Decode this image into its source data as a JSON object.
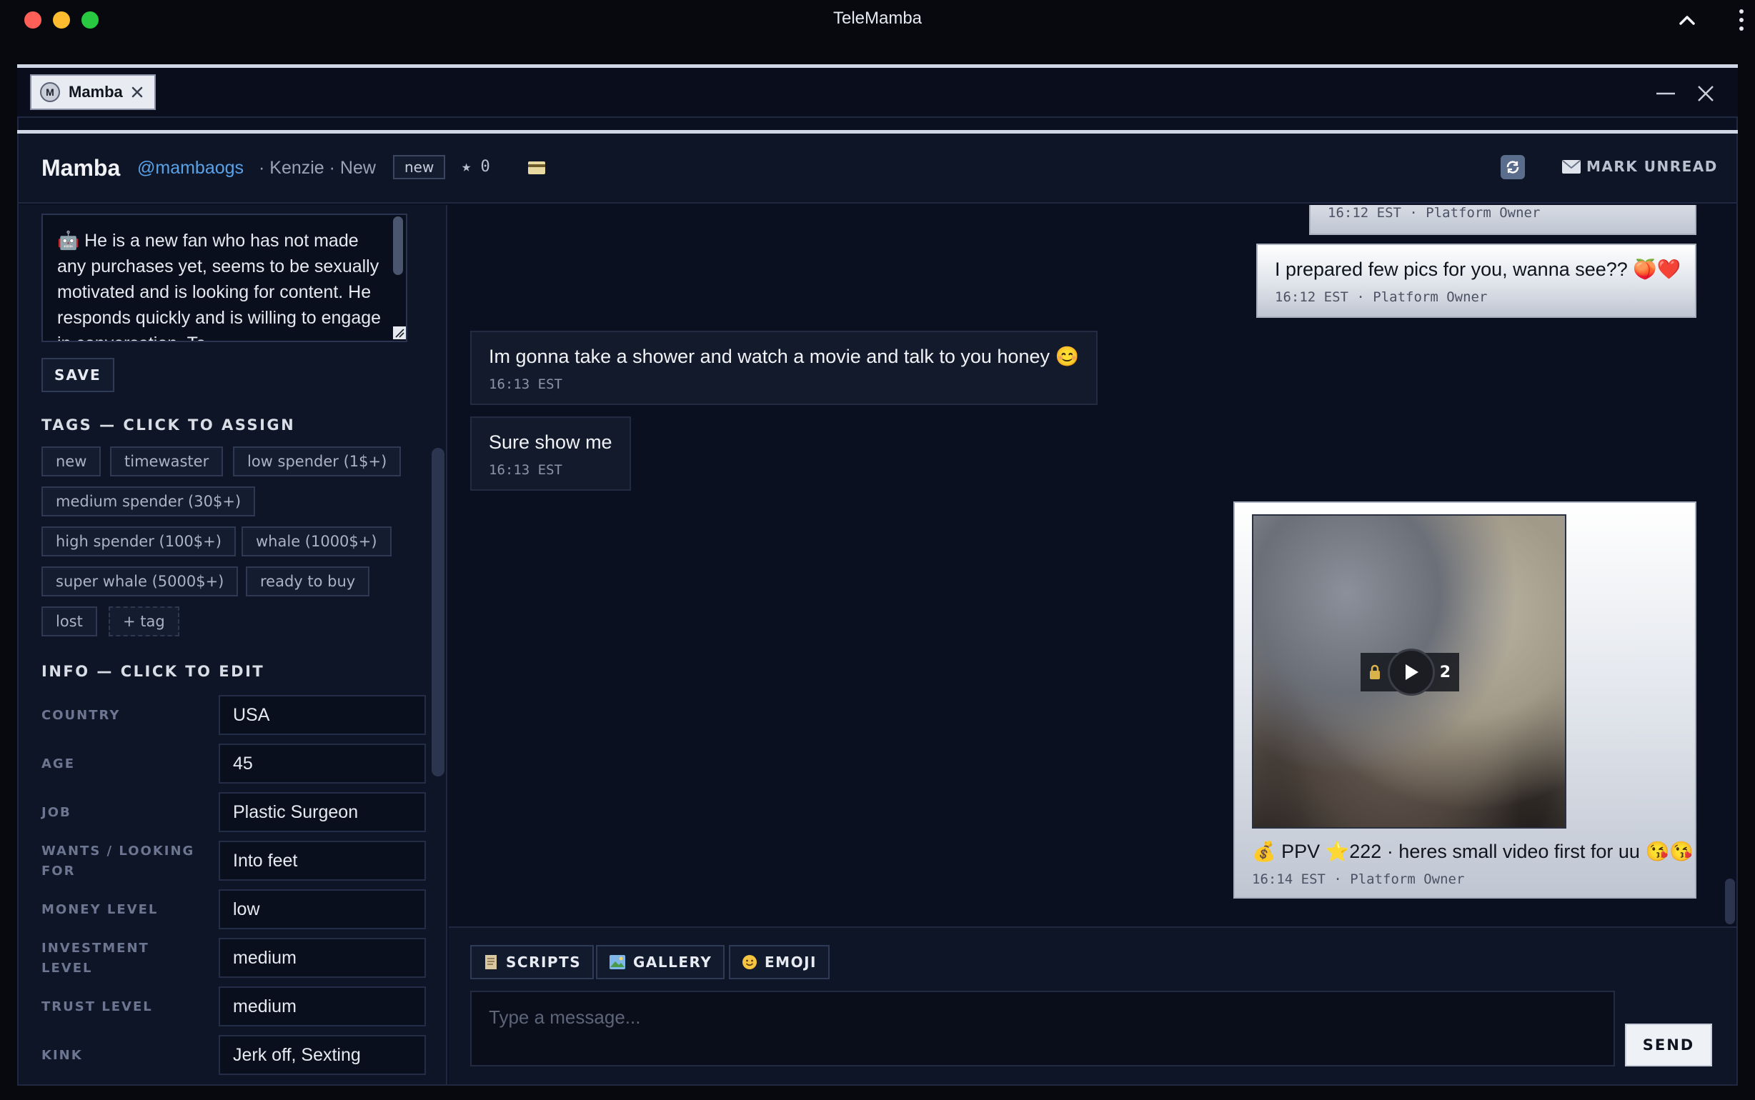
{
  "app": {
    "title": "TeleMamba"
  },
  "tab": {
    "avatar_letter": "M",
    "label": "Mamba"
  },
  "header": {
    "name": "Mamba",
    "handle": "@mambaogs",
    "meta": "· Kenzie · New",
    "badge": "new",
    "stars": "★ 0",
    "mark_unread": "MARK UNREAD"
  },
  "notes": {
    "text": "🤖 He is a new fan who has not made any purchases yet, seems to be sexually motivated and is looking for content. He responds quickly and is willing to engage in conversation. To"
  },
  "save_label": "SAVE",
  "tags": {
    "title": "TAGS — CLICK TO ASSIGN",
    "items": [
      "new",
      "timewaster",
      "low spender (1$+)",
      "medium spender (30$+)",
      "high spender (100$+)",
      "whale (1000$+)",
      "super whale (5000$+)",
      "ready to buy",
      "lost",
      "+ tag"
    ]
  },
  "info": {
    "title": "INFO — CLICK TO EDIT",
    "rows": [
      {
        "label": "COUNTRY",
        "value": "USA"
      },
      {
        "label": "AGE",
        "value": "45"
      },
      {
        "label": "JOB",
        "value": "Plastic Surgeon"
      },
      {
        "label": "WANTS / LOOKING FOR",
        "value": "Into feet"
      },
      {
        "label": "MONEY LEVEL",
        "value": "low"
      },
      {
        "label": "INVESTMENT LEVEL",
        "value": "medium"
      },
      {
        "label": "TRUST LEVEL",
        "value": "medium"
      },
      {
        "label": "KINK",
        "value": "Jerk off, Sexting"
      }
    ]
  },
  "messages": [
    {
      "dir": "out",
      "text": "",
      "meta": "16:12 EST · Platform Owner"
    },
    {
      "dir": "out",
      "text": "I prepared few pics for you, wanna see?? 🍑❤️",
      "meta": "16:12 EST · Platform Owner"
    },
    {
      "dir": "in",
      "text": "Im gonna take a shower and watch a movie and talk to you honey 😊",
      "meta": "16:13 EST"
    },
    {
      "dir": "in",
      "text": "Sure show me",
      "meta": "16:13 EST"
    },
    {
      "dir": "out",
      "media_count": "2",
      "text": "💰 PPV ⭐222 · heres small video first for uu 😘😘",
      "meta": "16:14 EST · Platform Owner"
    }
  ],
  "composer": {
    "scripts": "SCRIPTS",
    "gallery": "GALLERY",
    "emoji": "EMOJI",
    "placeholder": "Type a message...",
    "send": "SEND"
  }
}
